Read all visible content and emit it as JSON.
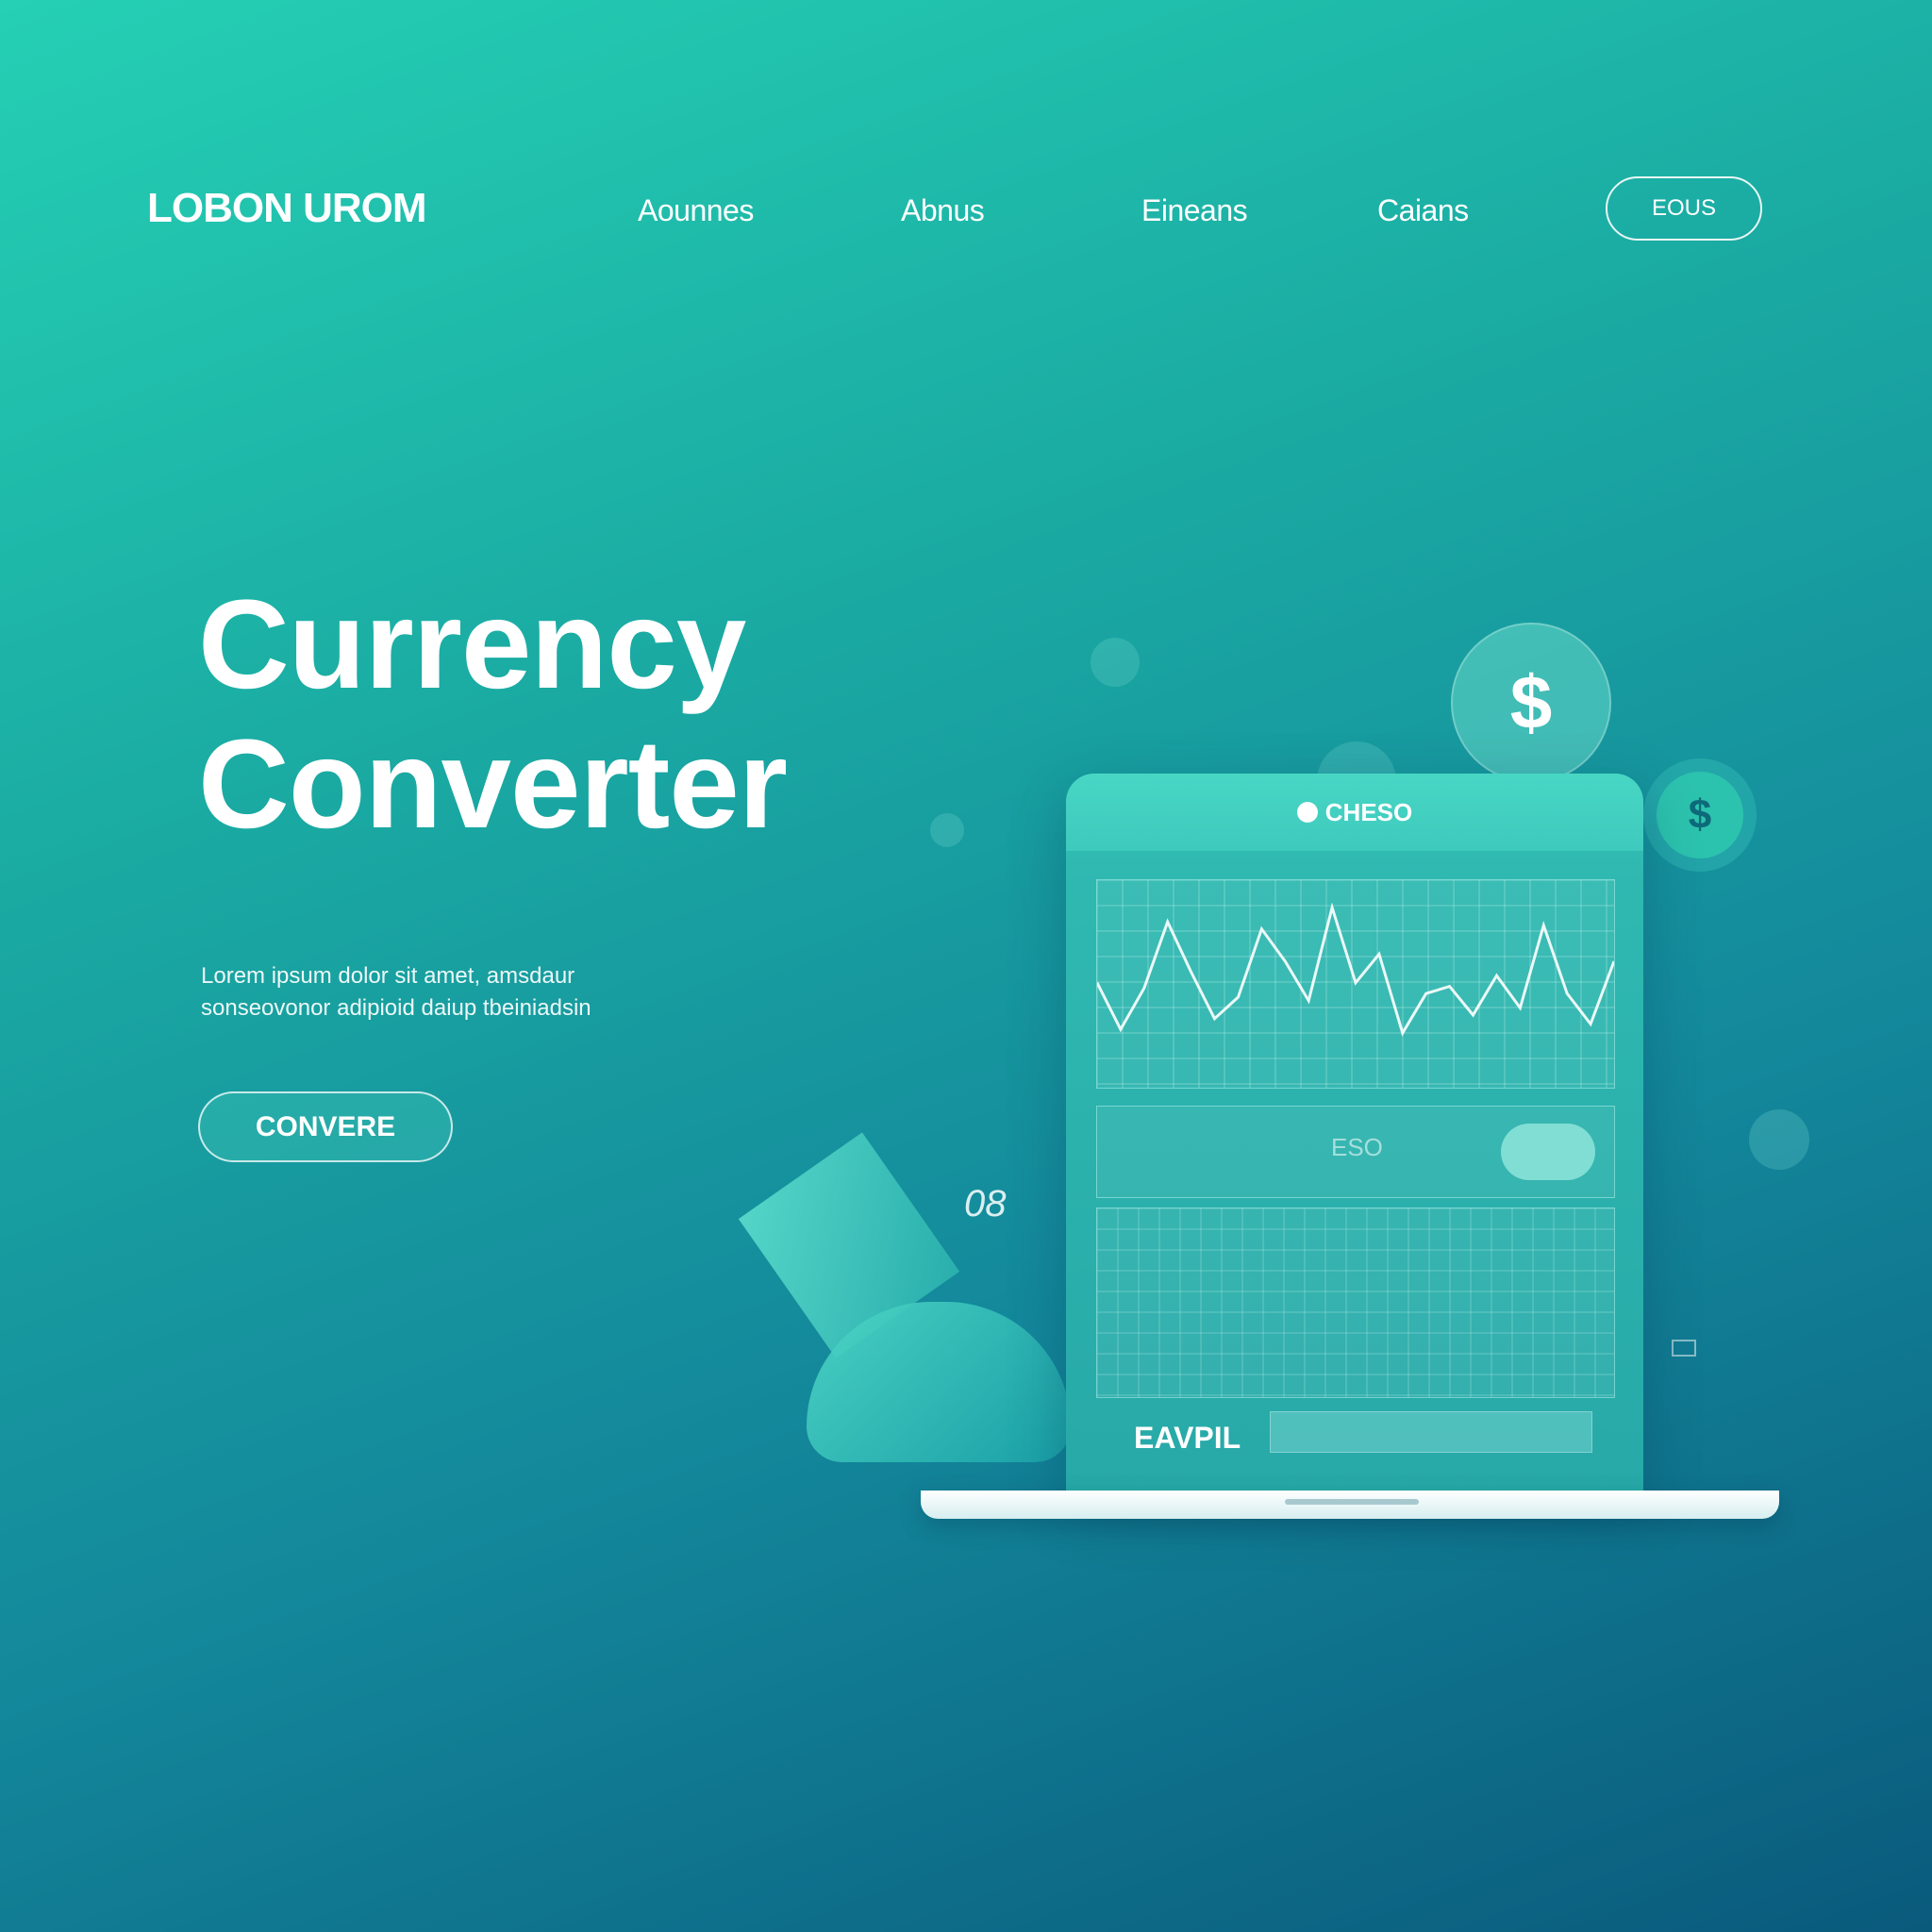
{
  "nav": {
    "logo": "LOBON UROM",
    "links": [
      "Aounnes",
      "Abnus",
      "Eineans",
      "Caians"
    ],
    "button": "EOUS"
  },
  "hero": {
    "title_line1": "Currency",
    "title_line2": "Converter",
    "text_line1": "Lorem ipsum dolor sit amet, amsdaur",
    "text_line2": "sonseovonor adipioid daiup tbeiniadsin",
    "cta": "CONVERE"
  },
  "screen": {
    "header": "CHESO",
    "panel_label": "ESO",
    "bottom_label": "EAVPIL",
    "chart_points": [
      0.52,
      0.78,
      0.55,
      0.18,
      0.46,
      0.72,
      0.6,
      0.22,
      0.4,
      0.62,
      0.1,
      0.52,
      0.36,
      0.8,
      0.58,
      0.54,
      0.7,
      0.48,
      0.66,
      0.2,
      0.58,
      0.75,
      0.4
    ]
  },
  "illustration": {
    "coin_big": "$",
    "coin_small": "$",
    "number": "08"
  },
  "colors": {
    "bg_top": "#25d0b4",
    "bg_bottom": "#0a5a7c",
    "accent": "#2cc3ae"
  }
}
